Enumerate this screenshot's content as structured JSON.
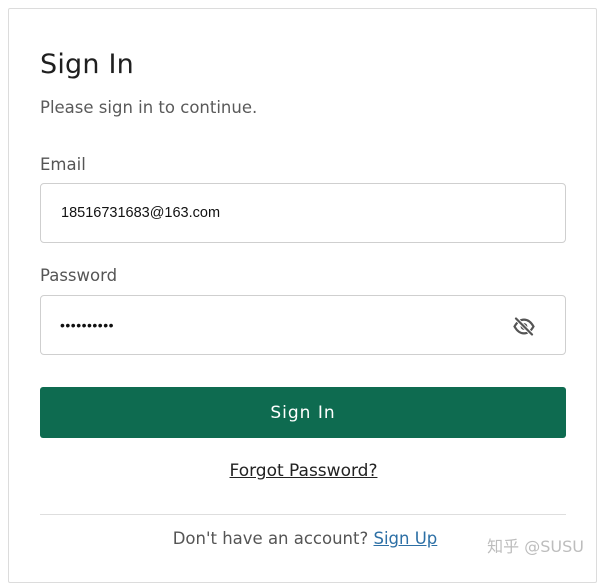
{
  "form": {
    "title": "Sign In",
    "subtitle": "Please sign in to continue.",
    "email_label": "Email",
    "email_value": "18516731683@163.com",
    "password_label": "Password",
    "password_mask": "••••••••••",
    "password_toggle_icon": "eye-slash-icon",
    "submit_label": "Sign In",
    "forgot_link": "Forgot Password?",
    "signup_prompt": "Don't have an account?",
    "signup_link": "Sign Up"
  },
  "colors": {
    "primary": "#0e6b50",
    "link": "#2c6fa5"
  },
  "watermark": "知乎 @SUSU"
}
